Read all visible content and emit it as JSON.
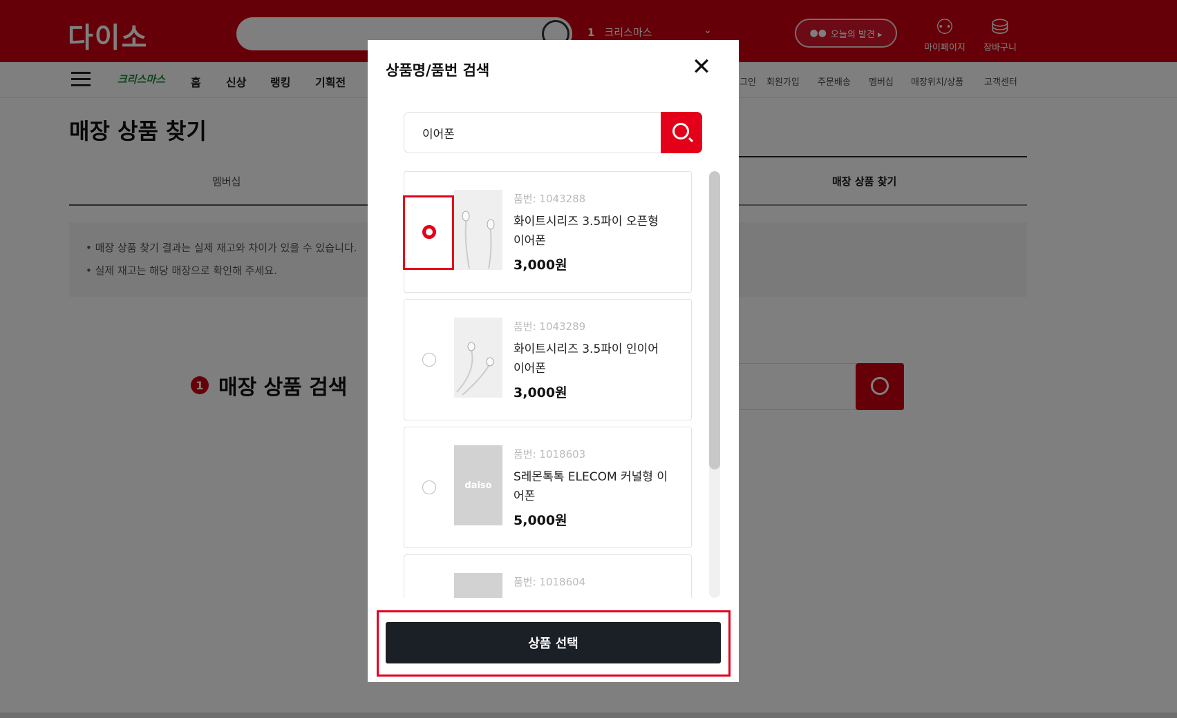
{
  "header": {
    "logo": "다이소",
    "rank_number": "1",
    "rank_term": "크리스마스",
    "rank_toggle": "⌄",
    "today_pill": "오늘의 발견 ▸",
    "mypage_label": "마이페이지",
    "cart_label": "장바구니"
  },
  "nav": {
    "xmas_logo": "크리스마스",
    "items": [
      "홈",
      "신상",
      "랭킹",
      "기획전"
    ],
    "util": [
      "그인",
      "회원가입",
      "주문배송",
      "멤버십",
      "매장위치/상품",
      "고객센터"
    ]
  },
  "page": {
    "title": "매장 상품 찾기",
    "tabs": [
      "멤버십",
      "매장 상품 찾기"
    ],
    "notices": [
      "매장 상품 찾기 결과는 실제 재고와 차이가 있을 수 있습니다.",
      "실제 재고는 해당 매장으로 확인해 주세요."
    ],
    "step_number": "1",
    "step_title": "매장 상품 검색"
  },
  "modal": {
    "title": "상품명/품번 검색",
    "search_value": "이어폰",
    "products": [
      {
        "code": "품번: 1043288",
        "name": "화이트시리즈 3.5파이 오픈형 이어폰",
        "price": "3,000원",
        "selected": true
      },
      {
        "code": "품번: 1043289",
        "name": "화이트시리즈 3.5파이 인이어 이어폰",
        "price": "3,000원",
        "selected": false
      },
      {
        "code": "품번: 1018603",
        "name": "S레몬톡톡 ELECOM 커널형 이어폰",
        "price": "5,000원",
        "selected": false,
        "thumb_text": "daiso"
      },
      {
        "code": "품번: 1018604",
        "name": "",
        "price": "",
        "selected": false
      }
    ],
    "select_button": "상품 선택"
  },
  "colors": {
    "brand_red": "#cc0010",
    "accent_red": "#e5001a",
    "button_dark": "#1b1f26"
  }
}
